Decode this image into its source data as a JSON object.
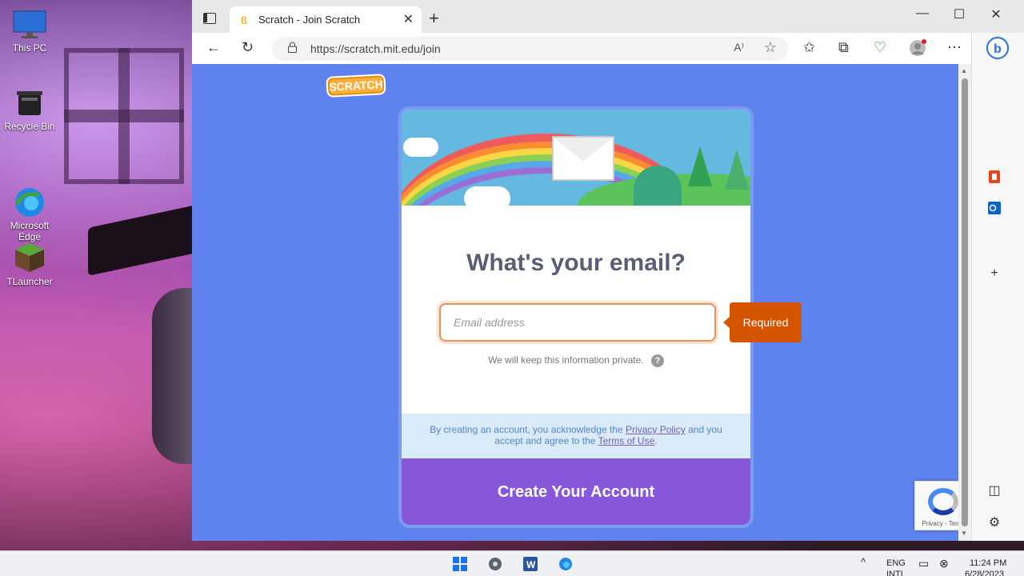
{
  "desktop": {
    "icons": [
      {
        "label": "This PC"
      },
      {
        "label": "Recycle Bin"
      },
      {
        "label": "Microsoft\nEdge"
      },
      {
        "label": "TLauncher"
      }
    ]
  },
  "browser": {
    "tab_title": "Scratch - Join Scratch",
    "tab_close": "✕",
    "new_tab": "+",
    "win_minimize": "—",
    "win_maximize": "☐",
    "win_close": "✕",
    "url": "https://scratch.mit.edu/join",
    "read_aloud": "A⁾",
    "favorite_star": "☆"
  },
  "page": {
    "logo_text": "SCRATCH",
    "heading": "What's your email?",
    "email_placeholder": "Email address",
    "privacy_note": "We will keep this information private.",
    "help_icon": "?",
    "required_label": "Required",
    "terms_prefix": "By creating an account, you acknowledge the ",
    "privacy_link": "Privacy Policy",
    "terms_middle": " and you accept and agree to the ",
    "terms_link": "Terms of Use",
    "terms_suffix": ".",
    "create_button": "Create Your Account",
    "recaptcha_text": "Privacy - Terms"
  },
  "taskbar": {
    "language": "ENG",
    "language_sub": "INTL",
    "time": "11:24 PM",
    "date": "6/28/2023"
  },
  "colors": {
    "page_bg": "#5f83ee",
    "create_button": "#8657da",
    "required_tip": "#d55400",
    "input_border": "#e9905b"
  }
}
